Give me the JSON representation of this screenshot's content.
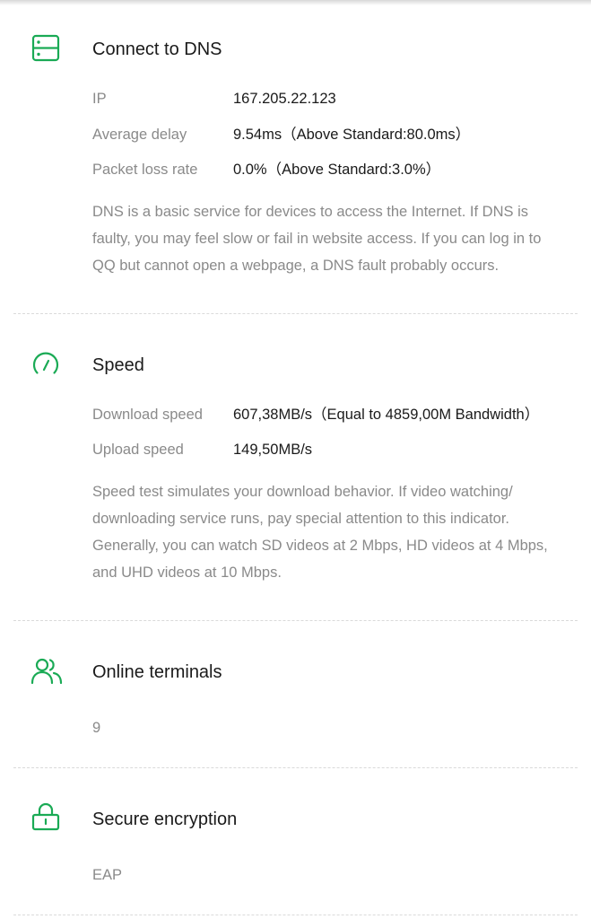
{
  "colors": {
    "accent": "#1aaa55",
    "title": "#1a1a1a",
    "label": "#8a8a8a",
    "divider": "#dadada"
  },
  "dns": {
    "icon": "server-icon",
    "title": "Connect to DNS",
    "rows": [
      {
        "label": "IP",
        "value": "167.205.22.123"
      },
      {
        "label": "Average delay",
        "value": "9.54ms（Above Standard:80.0ms）"
      },
      {
        "label": "Packet loss rate",
        "value": "0.0%（Above Standard:3.0%）"
      }
    ],
    "description": "DNS is a basic service for devices to access the Internet. If DNS is faulty, you may feel slow or fail in website access. If you can log in to QQ but cannot open a webpage, a DNS fault probably occurs."
  },
  "speed": {
    "icon": "speedometer-icon",
    "title": "Speed",
    "rows": [
      {
        "label": "Download speed",
        "value": "607,38MB/s（Equal to 4859,00M Bandwidth）"
      },
      {
        "label": "Upload speed",
        "value": "149,50MB/s"
      }
    ],
    "description": "Speed test simulates your download behavior. If video watching/ downloading service runs, pay special attention to this indicator. Generally, you can watch SD videos at 2 Mbps, HD videos at 4 Mbps, and UHD videos at 10 Mbps."
  },
  "terminals": {
    "icon": "users-icon",
    "title": "Online terminals",
    "value": "9"
  },
  "encryption": {
    "icon": "lock-icon",
    "title": "Secure encryption",
    "value": "EAP"
  }
}
